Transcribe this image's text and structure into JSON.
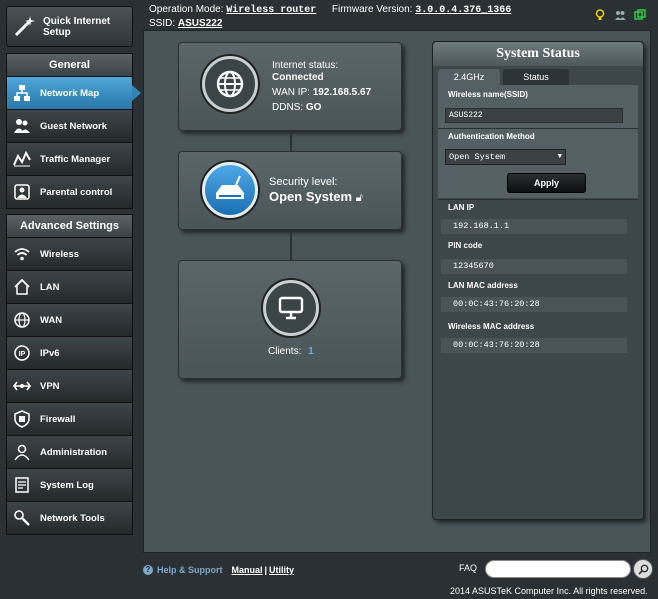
{
  "quick_setup": {
    "label_line1": "Quick Internet",
    "label_line2": "Setup"
  },
  "topbar": {
    "operation_mode_label": "Operation Mode:",
    "operation_mode": "Wireless router",
    "firmware_label": "Firmware Version:",
    "firmware": "3.0.0.4.376_1366",
    "ssid_label": "SSID:",
    "ssid": "ASUS222"
  },
  "sidebar": {
    "general_header": "General",
    "general_items": [
      {
        "label": "Network Map",
        "icon": "network-map-icon"
      },
      {
        "label": "Guest Network",
        "icon": "guest-network-icon"
      },
      {
        "label": "Traffic Manager",
        "icon": "traffic-manager-icon"
      },
      {
        "label": "Parental control",
        "icon": "parental-control-icon"
      }
    ],
    "advanced_header": "Advanced Settings",
    "advanced_items": [
      {
        "label": "Wireless",
        "icon": "wireless-icon"
      },
      {
        "label": "LAN",
        "icon": "lan-icon"
      },
      {
        "label": "WAN",
        "icon": "wan-icon"
      },
      {
        "label": "IPv6",
        "icon": "ipv6-icon"
      },
      {
        "label": "VPN",
        "icon": "vpn-icon"
      },
      {
        "label": "Firewall",
        "icon": "firewall-icon"
      },
      {
        "label": "Administration",
        "icon": "administration-icon"
      },
      {
        "label": "System Log",
        "icon": "system-log-icon"
      },
      {
        "label": "Network Tools",
        "icon": "network-tools-icon"
      }
    ]
  },
  "map": {
    "internet": {
      "status_label": "Internet status:",
      "status": "Connected",
      "wan_ip_label": "WAN IP:",
      "wan_ip": "192.168.5.67",
      "ddns_label": "DDNS:",
      "ddns": "GO"
    },
    "router": {
      "security_label": "Security level:",
      "security": "Open System"
    },
    "clients": {
      "label": "Clients:",
      "count": "1"
    }
  },
  "system_status": {
    "title": "System Status",
    "tabs": [
      "2.4GHz",
      "Status"
    ],
    "ssid_label": "Wireless name(SSID)",
    "ssid_value": "ASUS222",
    "auth_label": "Authentication Method",
    "auth_value": "Open System",
    "apply_label": "Apply",
    "lan_ip_label": "LAN IP",
    "lan_ip": "192.168.1.1",
    "pin_label": "PIN code",
    "pin": "12345670",
    "lan_mac_label": "LAN MAC address",
    "lan_mac": "00:0C:43:76:20:28",
    "wl_mac_label": "Wireless MAC address",
    "wl_mac": "00:0C:43:76:20:28"
  },
  "footer": {
    "help": "Help & Support",
    "manual": "Manual",
    "sep": "|",
    "utility": "Utility",
    "faq": "FAQ",
    "copyright": "2014 ASUSTeK Computer Inc. All rights reserved."
  },
  "colors": {
    "accent": "#2f84b8",
    "link": "#7ea7c9"
  }
}
